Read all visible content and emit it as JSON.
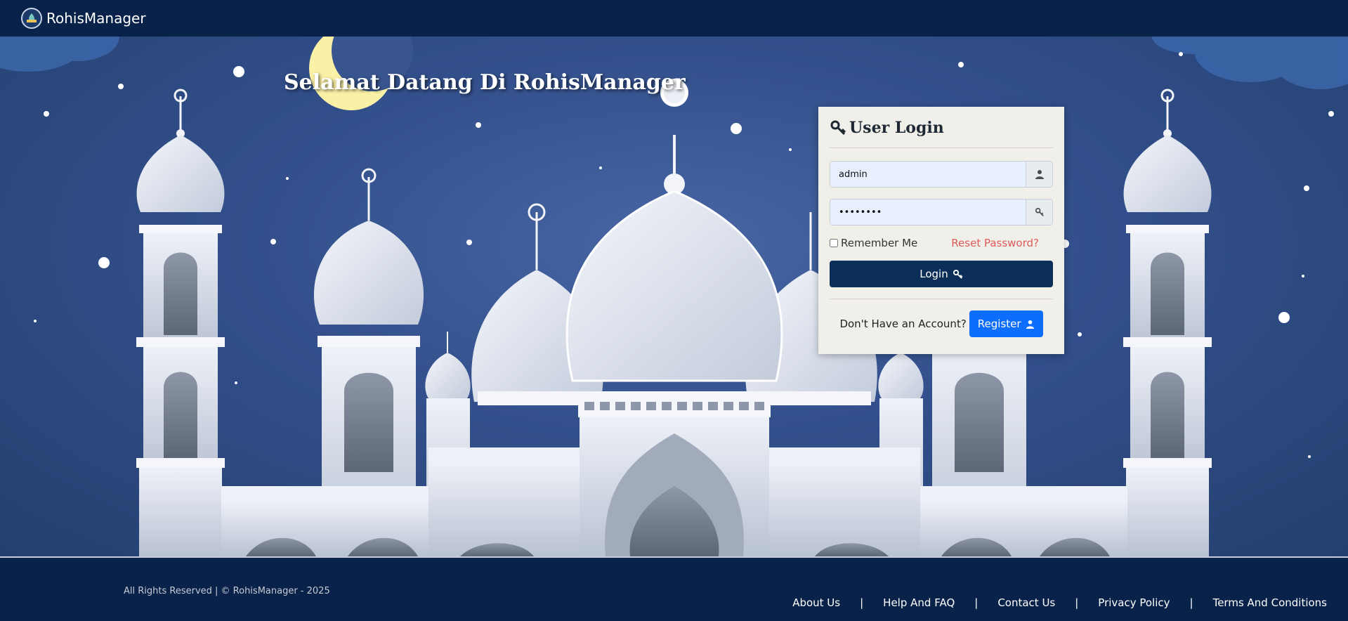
{
  "navbar": {
    "brand": "RohisManager",
    "logo_icon": "mosque-logo-icon"
  },
  "hero": {
    "welcome": "Selamat Datang Di RohisManager"
  },
  "login": {
    "title": "User Login",
    "title_icon": "key-icon",
    "username_value": "admin",
    "username_icon": "user-icon",
    "password_value": "••••••••",
    "password_icon": "key-icon",
    "remember_label": "Remember Me",
    "reset_label": "Reset Password?",
    "login_button": "Login",
    "no_account_text": "Don't Have an Account?",
    "register_button": "Register"
  },
  "footer": {
    "copyright": "All Rights Reserved | © RohisManager - 2025",
    "links": [
      "About Us",
      "Help And FAQ",
      "Contact Us",
      "Privacy Policy",
      "Terms And Conditions"
    ],
    "separator": "|"
  },
  "colors": {
    "navy": "#08224a",
    "sky": "#324f8b",
    "login_button": "#0a2e57",
    "register_button": "#0d6efd",
    "reset_link": "#e05a5a"
  }
}
